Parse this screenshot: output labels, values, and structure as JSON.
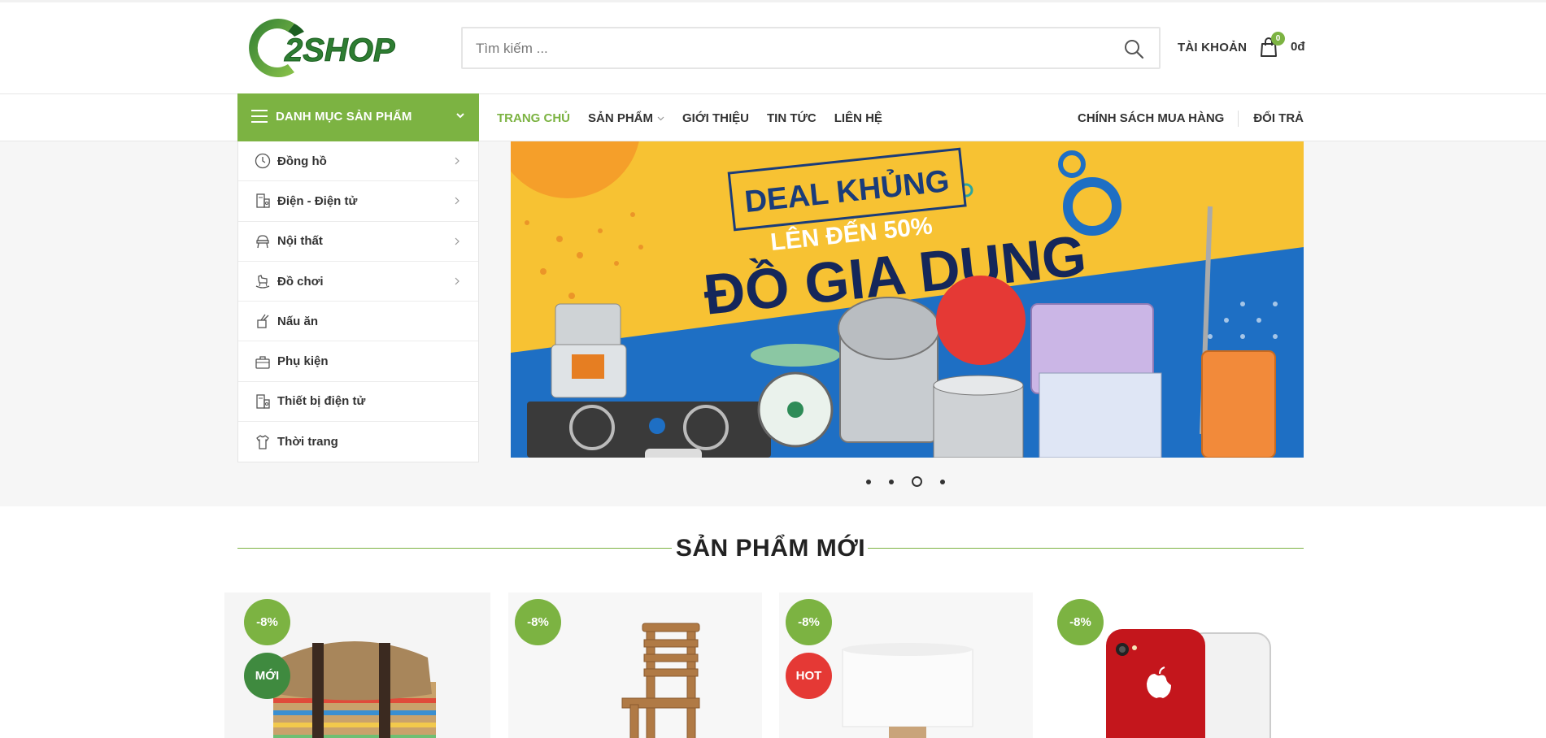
{
  "brand": {
    "logo_text": "2SHOP",
    "accent": "#7cb342"
  },
  "search": {
    "placeholder": "Tìm kiếm ..."
  },
  "header": {
    "account_label": "TÀI KHOẢN",
    "cart_count": "0",
    "cart_total": "0đ"
  },
  "nav": {
    "categories_label": "DANH MỤC SẢN PHẨM",
    "main": [
      {
        "label": "TRANG CHỦ",
        "active": true
      },
      {
        "label": "SẢN PHẨM",
        "dropdown": true
      },
      {
        "label": "GIỚI THIỆU"
      },
      {
        "label": "TIN TỨC"
      },
      {
        "label": "LIÊN HỆ"
      }
    ],
    "right": [
      {
        "label": "CHÍNH SÁCH MUA HÀNG"
      },
      {
        "label": "ĐỔI TRẢ"
      }
    ]
  },
  "categories": [
    {
      "label": "Đồng hồ",
      "icon": "clock-icon",
      "has_sub": true
    },
    {
      "label": "Điện - Điện tử",
      "icon": "appliance-icon",
      "has_sub": true
    },
    {
      "label": "Nội thất",
      "icon": "chair-icon",
      "has_sub": true
    },
    {
      "label": "Đồ chơi",
      "icon": "rocking-horse-icon",
      "has_sub": true
    },
    {
      "label": "Nấu ăn",
      "icon": "kitchen-icon",
      "has_sub": false
    },
    {
      "label": "Phụ kiện",
      "icon": "bag-icon",
      "has_sub": false
    },
    {
      "label": "Thiết bị điện tử",
      "icon": "appliance-icon",
      "has_sub": false
    },
    {
      "label": "Thời trang",
      "icon": "shirt-icon",
      "has_sub": false
    }
  ],
  "banner": {
    "line1": "DEAL KHỦNG",
    "line2": "LÊN ĐẾN 50%",
    "line3": "ĐỒ GIA DỤNG",
    "slides": 4,
    "active_slide": 3
  },
  "section": {
    "title": "SẢN PHẨM MỚI"
  },
  "products": [
    {
      "discount": "-8%",
      "tag": "MỚI",
      "tag_type": "new",
      "image": "cushion-on-books"
    },
    {
      "discount": "-8%",
      "tag": "",
      "tag_type": "",
      "image": "wooden-chair"
    },
    {
      "discount": "-8%",
      "tag": "HOT",
      "tag_type": "hot",
      "image": "table-lamp"
    },
    {
      "discount": "-8%",
      "tag": "",
      "tag_type": "",
      "image": "red-iphone"
    }
  ]
}
